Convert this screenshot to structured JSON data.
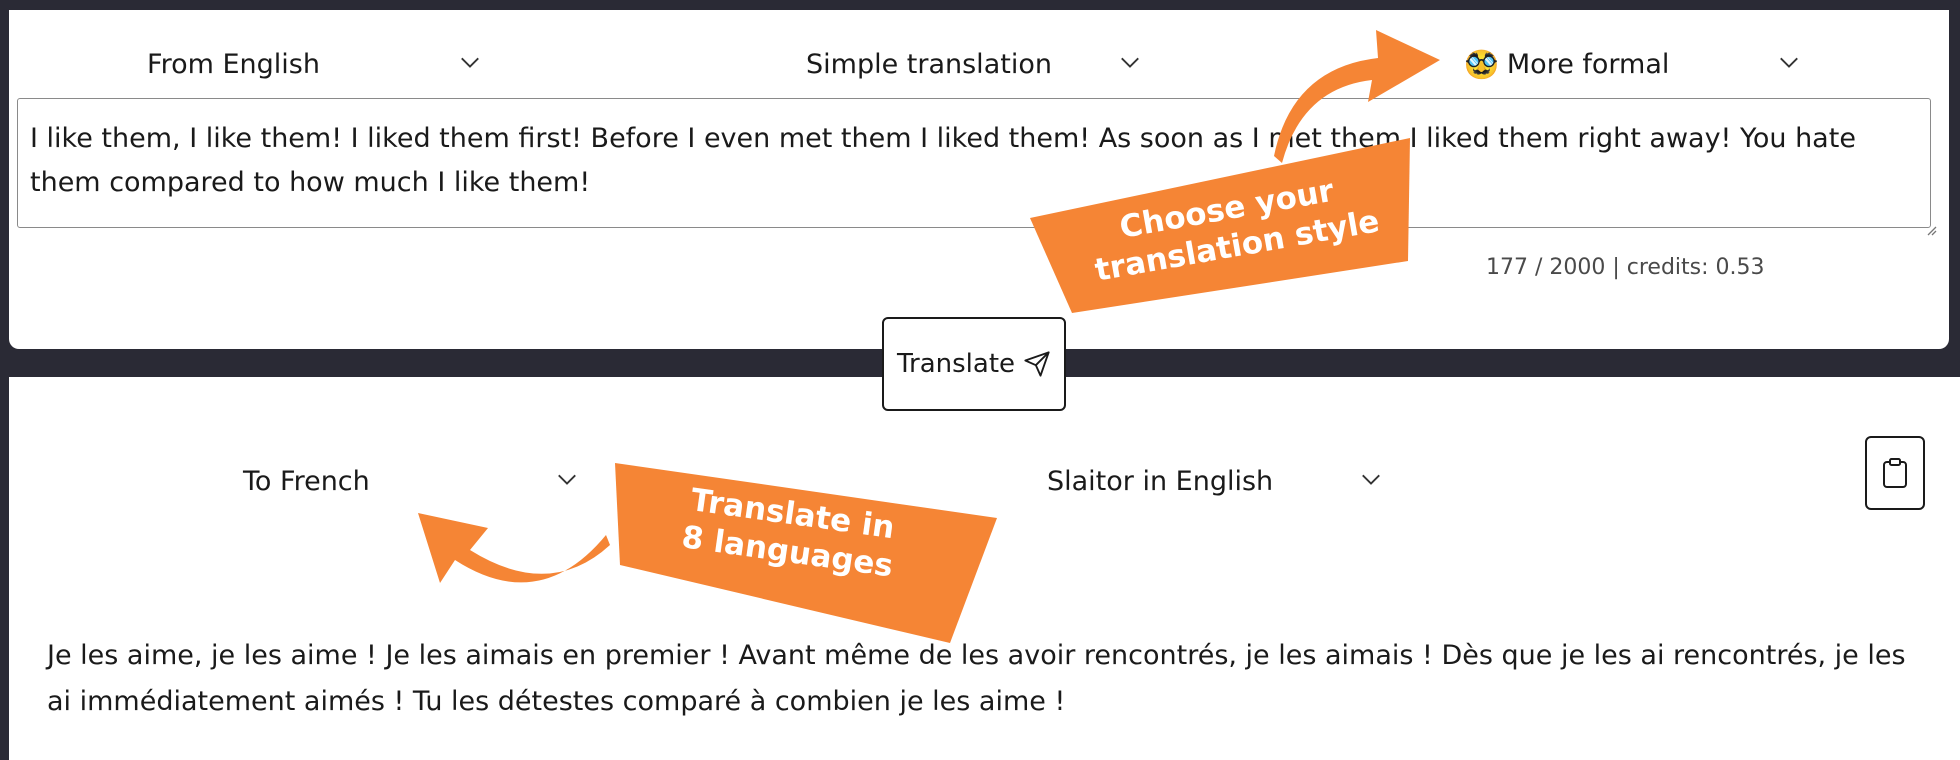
{
  "source": {
    "from_language": "From English",
    "mode": "Simple translation",
    "style_emoji": "🥸",
    "style": "More formal",
    "text": "I like them, I like them! I liked them first! Before I even met them I liked them! As soon as I met them I liked them right away! You hate them compared to how much I like them!",
    "counter": "177 / 2000 | credits: 0.53"
  },
  "translate_label": "Translate",
  "target": {
    "to_language": "To French",
    "interface_language": "Slaitor in English",
    "text": "Je les aime, je les aime ! Je les aimais en premier ! Avant même de les avoir rencontrés, je les aimais ! Dès que je les ai rencontrés, je les ai immédiatement aimés ! Tu les détestes comparé à combien je les aime !"
  },
  "annotations": {
    "style_line1": "Choose your",
    "style_line2": "translation style",
    "languages_line1": "Translate in",
    "languages_line2": "8 languages"
  },
  "colors": {
    "accent_orange": "#f58535",
    "frame": "#2a2a35"
  }
}
